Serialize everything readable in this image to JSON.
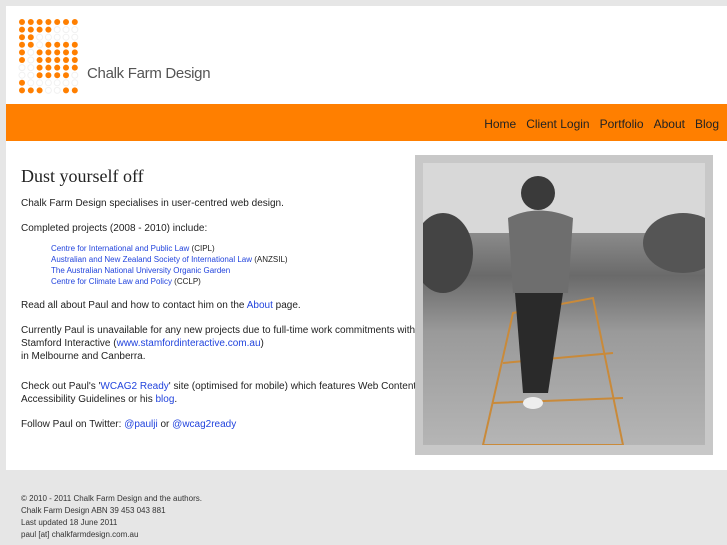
{
  "brand": {
    "name": "Chalk Farm Design",
    "accent": "#ff7f00"
  },
  "nav": {
    "items": [
      {
        "label": "Home"
      },
      {
        "label": "Client Login"
      },
      {
        "label": "Portfolio"
      },
      {
        "label": "About"
      },
      {
        "label": "Blog"
      }
    ]
  },
  "main": {
    "title": "Dust yourself off",
    "intro": "Chalk Farm Design specialises in user-centred web design.",
    "projects_heading": "Completed projects (2008 - 2010) include:",
    "projects": [
      {
        "link": "Centre for International and Public Law",
        "suffix": " (CIPL)"
      },
      {
        "link": "Australian and New Zealand Society of International Law",
        "suffix": " (ANZSIL)"
      },
      {
        "link": "The Australian National University Organic Garden",
        "suffix": ""
      },
      {
        "link": "Centre for Climate Law and Policy",
        "suffix": " (CCLP)"
      }
    ],
    "about_pre": "Read all about Paul and how to contact him on the ",
    "about_link": "About",
    "about_post": " page.",
    "current_1": "Currently Paul is unavailable for any new projects due to full-time work commitments with Stamford Interactive (",
    "current_link": "www.stamfordinteractive.com.au",
    "current_2": ")",
    "current_3": "in Melbourne and Canberra.",
    "wcag_pre": "Check out Paul's '",
    "wcag_link": "WCAG2 Ready",
    "wcag_mid": "' site (optimised for mobile) which features Web Content Accessibility Guidelines or his ",
    "blog_link": "blog",
    "wcag_post": ".",
    "twitter_pre": "Follow Paul on Twitter: ",
    "twitter_1": "@paulji",
    "twitter_or": " or ",
    "twitter_2": "@wcag2ready"
  },
  "footer": {
    "lines": [
      "© 2010 - 2011 Chalk Farm Design and the authors.",
      "Chalk Farm Design ABN 39 453 043 881",
      "Last updated 18 June 2011",
      "paul [at] chalkfarmdesign.com.au"
    ]
  }
}
